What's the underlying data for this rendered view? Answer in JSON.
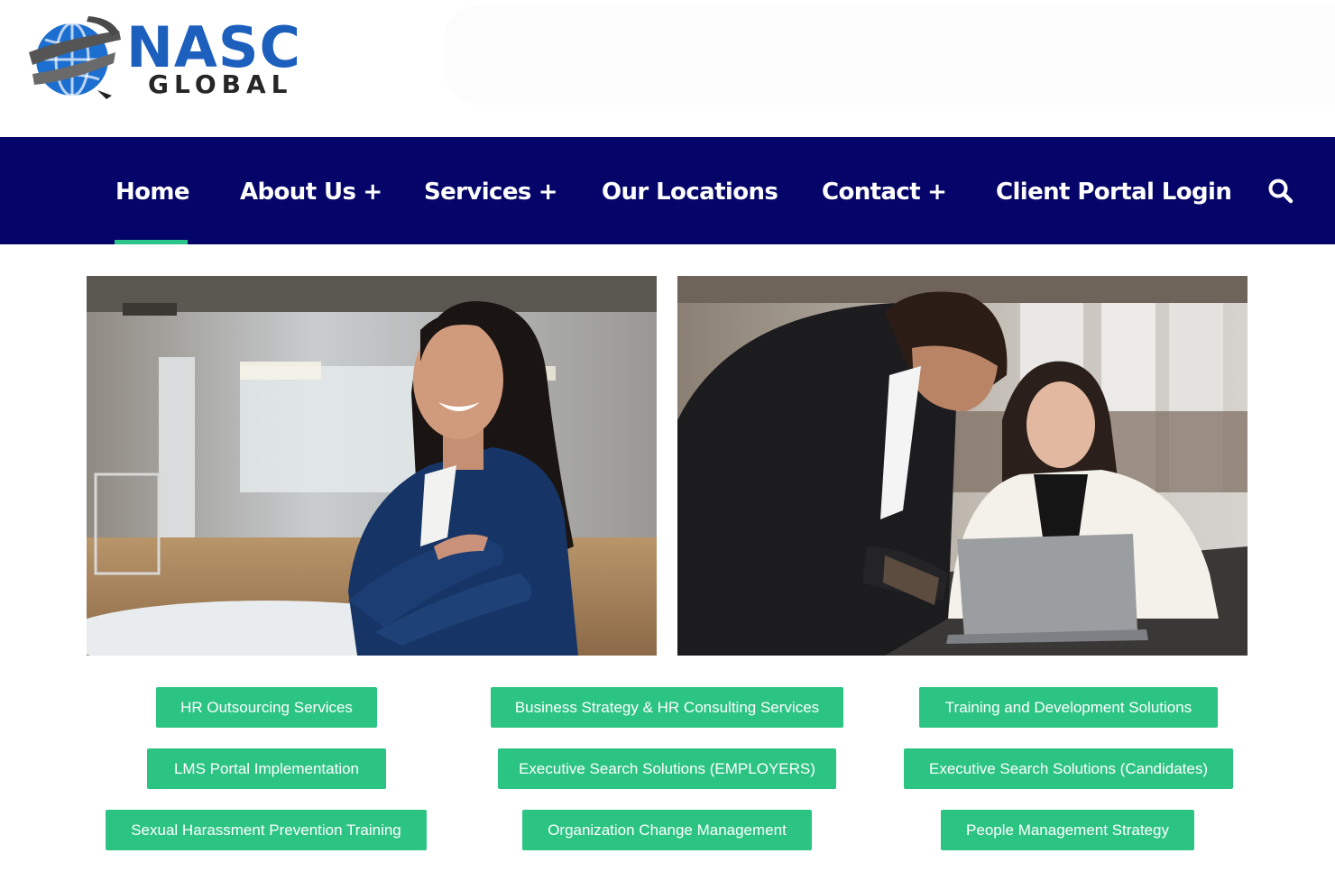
{
  "logo": {
    "primary": "NASC",
    "secondary": "GLOBAL",
    "icon": "globe-logo-icon"
  },
  "nav": {
    "items": [
      {
        "label": "Home",
        "plus": ""
      },
      {
        "label": "About Us",
        "plus": "+"
      },
      {
        "label": "Services",
        "plus": "+"
      },
      {
        "label": "Our Locations",
        "plus": ""
      },
      {
        "label": "Contact",
        "plus": "+"
      },
      {
        "label": "Client Portal Login",
        "plus": ""
      }
    ],
    "active": "Home",
    "search_icon": "search-icon"
  },
  "images": [
    {
      "icon": "photo-smiling-businesswoman"
    },
    {
      "icon": "photo-businessman-and-woman-at-laptop"
    }
  ],
  "services": [
    "HR Outsourcing Services",
    "Business Strategy & HR Consulting Services",
    "Training and Development Solutions",
    "LMS Portal Implementation",
    "Executive Search Solutions (EMPLOYERS)",
    "Executive Search Solutions (Candidates)",
    "Sexual Harassment Prevention Training",
    "Organization Change Management",
    "People Management Strategy"
  ],
  "colors": {
    "nav_bg": "#050569",
    "accent_green": "#2cc483",
    "brand_blue": "#1c5fbd"
  }
}
